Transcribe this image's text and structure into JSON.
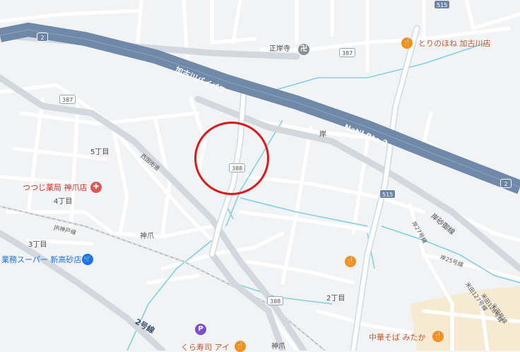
{
  "labels": {
    "bypass": "加古川バイパス",
    "natl_route": "Nat'l Rte 2",
    "temple": "正岸寺",
    "restaurant_tori": "とりのほね 加古川店",
    "kishi": "岸",
    "chome5": "5丁目",
    "nishi_kaido": "西国街道",
    "pharmacy": "つつじ薬局 神爪店",
    "chome4": "4丁目",
    "jr_line": "JR神戸線",
    "kazume": "神爪",
    "chome3": "3丁目",
    "supermarket": "業務スーパー 新高砂店",
    "kishisago": "岸砂御線",
    "no27": "岸27号線",
    "no25": "岸25号線",
    "chome2": "2丁目",
    "route2": "2号線",
    "yoneda127": "米田127号線",
    "yoneda126": "米田126号線",
    "yoneda125": "米田号線",
    "chuka": "中華そば みたか",
    "kura": "くら寿司 アイ",
    "kazume_bottom": "神爪"
  },
  "shields": {
    "r2_left": "2",
    "r2_right": "2",
    "r387_top": "387",
    "r387_left": "387",
    "r388_mid": "388",
    "r388_bottom": "388",
    "r515": "515",
    "r515_top": "515"
  },
  "icons": {
    "temple": "卍",
    "restaurant": "🍴",
    "pharmacy": "✚",
    "cart": "🛒",
    "parking": "P"
  },
  "colors": {
    "highway": "#7089a8",
    "road": "#ffffff",
    "major_road": "#d3d8df",
    "water": "#7fd1e6",
    "rail": "#b9bcc0",
    "block": "#e4e6ea",
    "circle": "#d91a1a",
    "commercial": "#f5e6c8"
  }
}
